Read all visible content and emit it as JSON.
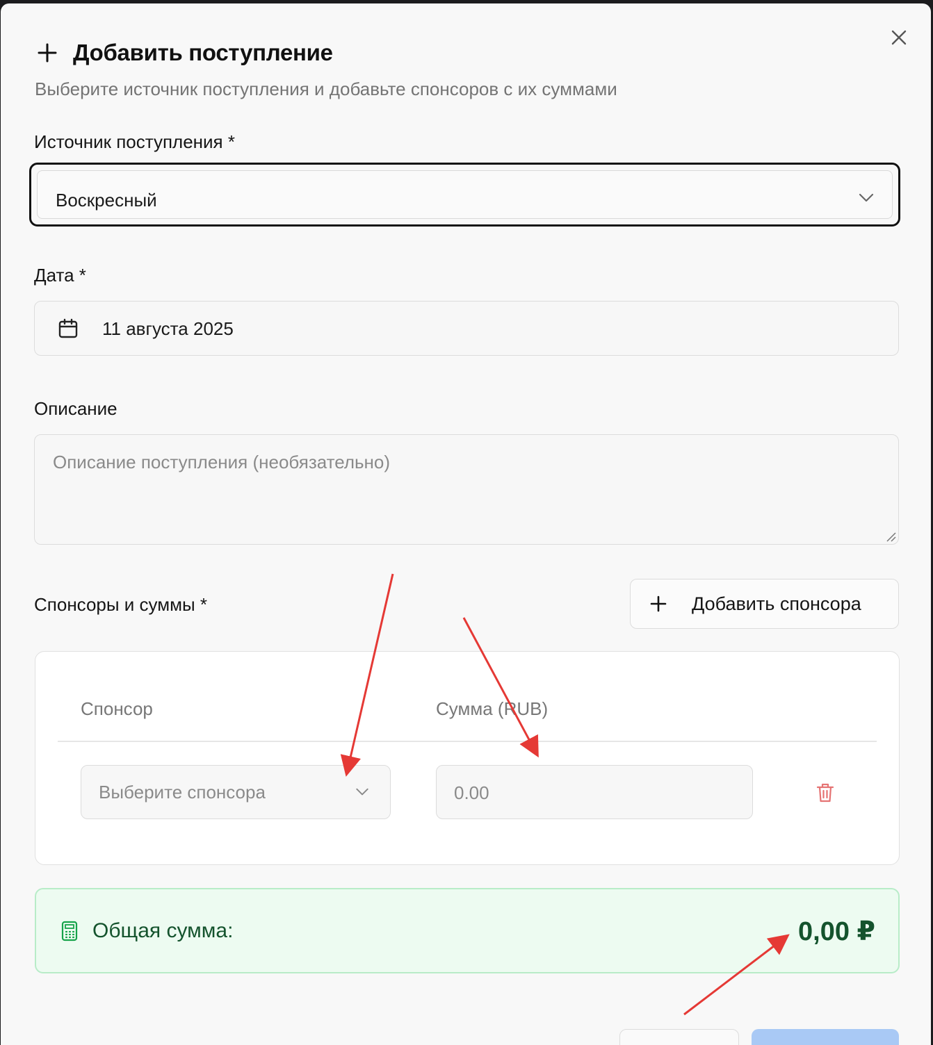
{
  "dialog": {
    "title": "Добавить поступление",
    "subtitle": "Выберите источник поступления и добавьте спонсоров с их суммами"
  },
  "source": {
    "label": "Источник поступления *",
    "value": "Воскресный"
  },
  "date": {
    "label": "Дата *",
    "value": "11 августа 2025"
  },
  "description": {
    "label": "Описание",
    "placeholder": "Описание поступления (необязательно)"
  },
  "sponsors": {
    "label": "Спонсоры и суммы *",
    "add_button": "Добавить спонсора",
    "columns": [
      "Спонсор",
      "Сумма (RUB)"
    ],
    "row": {
      "sponsor_placeholder": "Выберите спонсора",
      "amount_placeholder": "0.00"
    }
  },
  "total": {
    "label": "Общая сумма:",
    "value": "0,00 ₽"
  },
  "colors": {
    "annotation_arrow": "#e53935",
    "total_text": "#14532d",
    "total_bg": "#edfbf1",
    "delete_icon": "#e57373",
    "primary_button": "#a9c9f5"
  },
  "icons": [
    "plus-icon",
    "close-icon",
    "chevron-down-icon",
    "calendar-icon",
    "trash-icon",
    "calculator-icon"
  ]
}
